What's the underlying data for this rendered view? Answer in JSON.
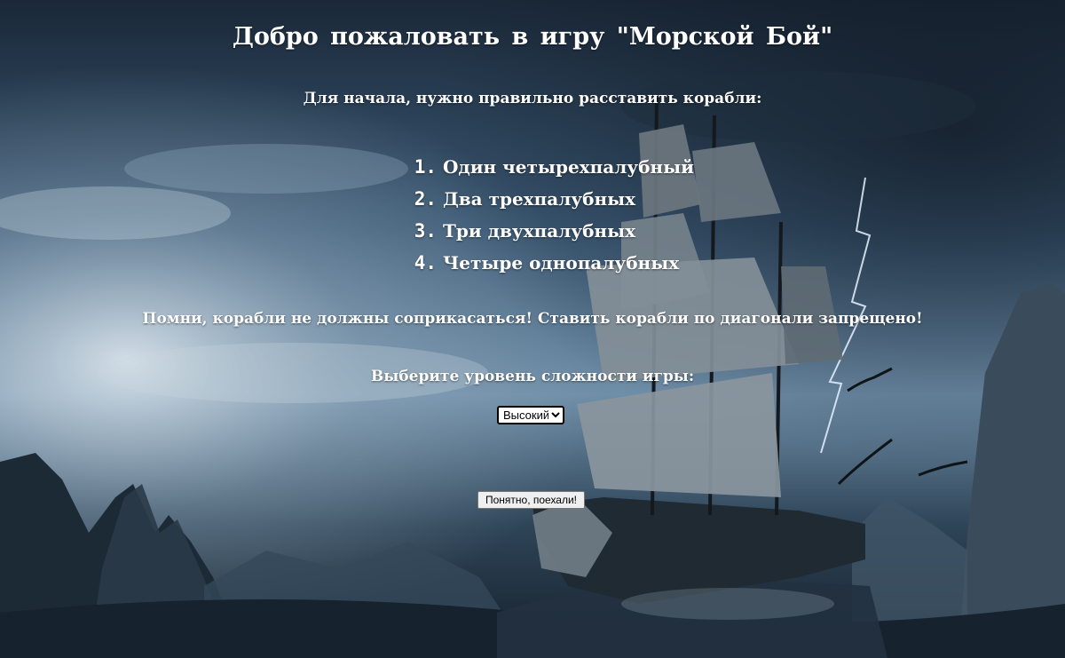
{
  "page": {
    "title": "Добро пожаловать в игру \"Морской Бой\"",
    "subtitle": "Для начала, нужно правильно расставить корабли:",
    "ships": [
      {
        "number": "1.",
        "text": "Один четырехпалубный"
      },
      {
        "number": "2.",
        "text": "Два трехпалубных"
      },
      {
        "number": "3.",
        "text": "Три двухпалубных"
      },
      {
        "number": "4.",
        "text": "Четыре однопалубных"
      }
    ],
    "warning": "Помни, корабли не должны соприкасаться! Ставить корабли по диагонали запрещено!",
    "level_label": "Выберите уровень сложности игры:",
    "level_selected": "Высокий",
    "start_button": "Понятно, поехали!"
  },
  "colors": {
    "sky_top": "#1c2c3d",
    "sky_mid": "#4a6a86",
    "sea": "#1a2a38",
    "text": "#ffffff"
  }
}
